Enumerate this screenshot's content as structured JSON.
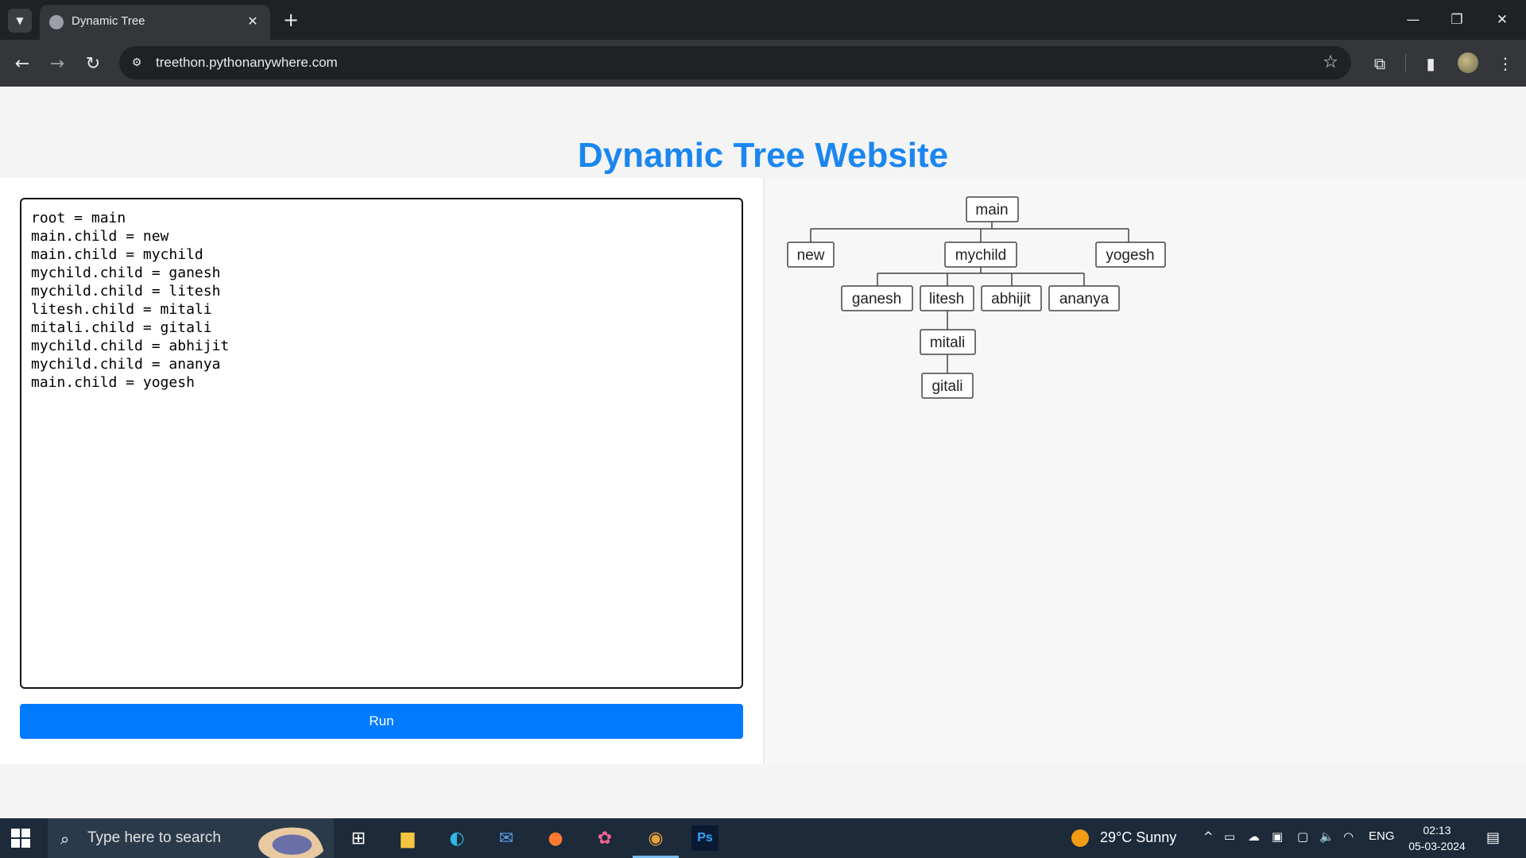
{
  "browser": {
    "tab_title": "Dynamic Tree",
    "url": "treethon.pythonanywhere.com",
    "new_tab_label": "+"
  },
  "page": {
    "heading": "Dynamic Tree Website",
    "code": "root = main\nmain.child = new\nmain.child = mychild\nmychild.child = ganesh\nmychild.child = litesh\nlitesh.child = mitali\nmitali.child = gitali\nmychild.child = abhijit\nmychild.child = ananya\nmain.child = yogesh",
    "run_label": "Run",
    "accent_color": "#007bff",
    "heading_color": "#1a86f0"
  },
  "tree": {
    "nodes": {
      "main": "main",
      "new": "new",
      "mychild": "mychild",
      "yogesh": "yogesh",
      "ganesh": "ganesh",
      "litesh": "litesh",
      "abhijit": "abhijit",
      "ananya": "ananya",
      "mitali": "mitali",
      "gitali": "gitali"
    }
  },
  "taskbar": {
    "search_placeholder": "Type here to search",
    "weather": "29°C  Sunny",
    "language": "ENG",
    "time": "02:13",
    "date": "05-03-2024"
  }
}
